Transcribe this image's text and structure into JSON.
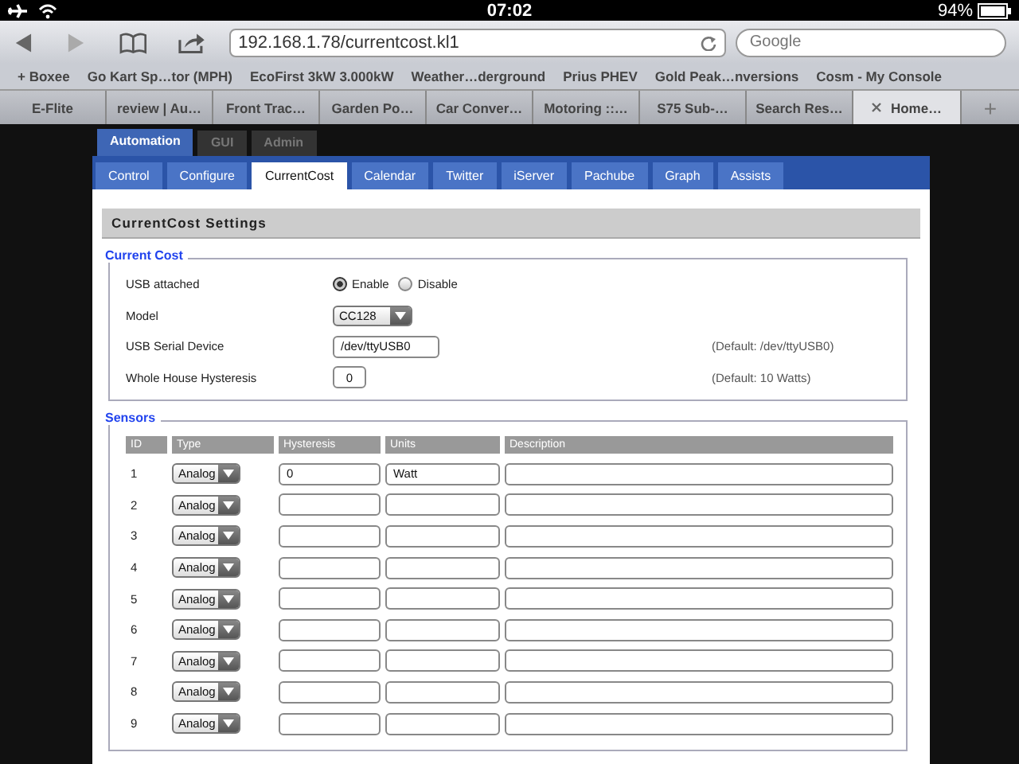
{
  "status_bar": {
    "time": "07:02",
    "battery": "94%"
  },
  "browser": {
    "url": "192.168.1.78/currentcost.kl1",
    "search_placeholder": "Google",
    "bookmarks": [
      "+ Boxee",
      "Go Kart Sp…tor (MPH)",
      "EcoFirst 3kW 3.000kW",
      "Weather…derground",
      "Prius PHEV",
      "Gold Peak…nversions",
      "Cosm - My Console"
    ],
    "tabs": [
      {
        "label": "E-Flite",
        "selected": false
      },
      {
        "label": "review | Au…",
        "selected": false
      },
      {
        "label": "Front Trac…",
        "selected": false
      },
      {
        "label": "Garden Po…",
        "selected": false
      },
      {
        "label": "Car Conver…",
        "selected": false
      },
      {
        "label": "Motoring ::…",
        "selected": false
      },
      {
        "label": "S75 Sub-…",
        "selected": false
      },
      {
        "label": "Search Res…",
        "selected": false
      },
      {
        "label": "Home…",
        "selected": true
      }
    ],
    "new_tab": "+"
  },
  "top_tabs": [
    {
      "label": "Automation",
      "selected": true
    },
    {
      "label": "GUI",
      "selected": false
    },
    {
      "label": "Admin",
      "selected": false
    }
  ],
  "sub_tabs": [
    {
      "label": "Control",
      "selected": false
    },
    {
      "label": "Configure",
      "selected": false
    },
    {
      "label": "CurrentCost",
      "selected": true
    },
    {
      "label": "Calendar",
      "selected": false
    },
    {
      "label": "Twitter",
      "selected": false
    },
    {
      "label": "iServer",
      "selected": false
    },
    {
      "label": "Pachube",
      "selected": false
    },
    {
      "label": "Graph",
      "selected": false
    },
    {
      "label": "Assists",
      "selected": false
    }
  ],
  "heading": "CurrentCost Settings",
  "current_cost": {
    "legend": "Current Cost",
    "usb_attached": {
      "label": "USB attached",
      "options": [
        {
          "label": "Enable",
          "selected": true
        },
        {
          "label": "Disable",
          "selected": false
        }
      ]
    },
    "model": {
      "label": "Model",
      "value": "CC128"
    },
    "serial": {
      "label": "USB Serial Device",
      "value": "/dev/ttyUSB0",
      "hint": "(Default: /dev/ttyUSB0)"
    },
    "hysteresis": {
      "label": "Whole House Hysteresis",
      "value": "0",
      "hint": "(Default: 10 Watts)"
    }
  },
  "sensors": {
    "legend": "Sensors",
    "columns": [
      "ID",
      "Type",
      "Hysteresis",
      "Units",
      "Description"
    ],
    "rows": [
      {
        "id": "1",
        "type": "Analog",
        "hysteresis": "0",
        "units": "Watt"
      },
      {
        "id": "2",
        "type": "Analog"
      },
      {
        "id": "3",
        "type": "Analog"
      },
      {
        "id": "4",
        "type": "Analog"
      },
      {
        "id": "5",
        "type": "Analog"
      },
      {
        "id": "6",
        "type": "Analog"
      },
      {
        "id": "7",
        "type": "Analog"
      },
      {
        "id": "8",
        "type": "Analog"
      },
      {
        "id": "9",
        "type": "Analog"
      }
    ]
  }
}
